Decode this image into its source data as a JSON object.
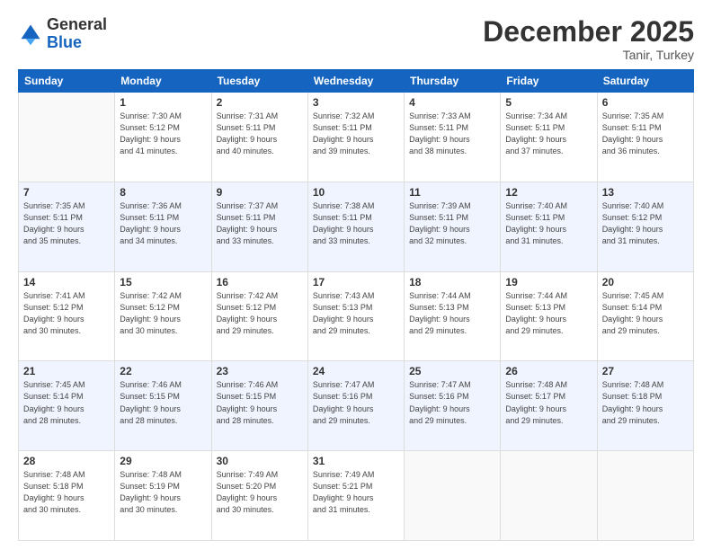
{
  "header": {
    "logo_general": "General",
    "logo_blue": "Blue",
    "month_title": "December 2025",
    "location": "Tanir, Turkey"
  },
  "days_of_week": [
    "Sunday",
    "Monday",
    "Tuesday",
    "Wednesday",
    "Thursday",
    "Friday",
    "Saturday"
  ],
  "weeks": [
    [
      {
        "num": "",
        "info": ""
      },
      {
        "num": "1",
        "info": "Sunrise: 7:30 AM\nSunset: 5:12 PM\nDaylight: 9 hours\nand 41 minutes."
      },
      {
        "num": "2",
        "info": "Sunrise: 7:31 AM\nSunset: 5:11 PM\nDaylight: 9 hours\nand 40 minutes."
      },
      {
        "num": "3",
        "info": "Sunrise: 7:32 AM\nSunset: 5:11 PM\nDaylight: 9 hours\nand 39 minutes."
      },
      {
        "num": "4",
        "info": "Sunrise: 7:33 AM\nSunset: 5:11 PM\nDaylight: 9 hours\nand 38 minutes."
      },
      {
        "num": "5",
        "info": "Sunrise: 7:34 AM\nSunset: 5:11 PM\nDaylight: 9 hours\nand 37 minutes."
      },
      {
        "num": "6",
        "info": "Sunrise: 7:35 AM\nSunset: 5:11 PM\nDaylight: 9 hours\nand 36 minutes."
      }
    ],
    [
      {
        "num": "7",
        "info": "Sunrise: 7:35 AM\nSunset: 5:11 PM\nDaylight: 9 hours\nand 35 minutes."
      },
      {
        "num": "8",
        "info": "Sunrise: 7:36 AM\nSunset: 5:11 PM\nDaylight: 9 hours\nand 34 minutes."
      },
      {
        "num": "9",
        "info": "Sunrise: 7:37 AM\nSunset: 5:11 PM\nDaylight: 9 hours\nand 33 minutes."
      },
      {
        "num": "10",
        "info": "Sunrise: 7:38 AM\nSunset: 5:11 PM\nDaylight: 9 hours\nand 33 minutes."
      },
      {
        "num": "11",
        "info": "Sunrise: 7:39 AM\nSunset: 5:11 PM\nDaylight: 9 hours\nand 32 minutes."
      },
      {
        "num": "12",
        "info": "Sunrise: 7:40 AM\nSunset: 5:11 PM\nDaylight: 9 hours\nand 31 minutes."
      },
      {
        "num": "13",
        "info": "Sunrise: 7:40 AM\nSunset: 5:12 PM\nDaylight: 9 hours\nand 31 minutes."
      }
    ],
    [
      {
        "num": "14",
        "info": "Sunrise: 7:41 AM\nSunset: 5:12 PM\nDaylight: 9 hours\nand 30 minutes."
      },
      {
        "num": "15",
        "info": "Sunrise: 7:42 AM\nSunset: 5:12 PM\nDaylight: 9 hours\nand 30 minutes."
      },
      {
        "num": "16",
        "info": "Sunrise: 7:42 AM\nSunset: 5:12 PM\nDaylight: 9 hours\nand 29 minutes."
      },
      {
        "num": "17",
        "info": "Sunrise: 7:43 AM\nSunset: 5:13 PM\nDaylight: 9 hours\nand 29 minutes."
      },
      {
        "num": "18",
        "info": "Sunrise: 7:44 AM\nSunset: 5:13 PM\nDaylight: 9 hours\nand 29 minutes."
      },
      {
        "num": "19",
        "info": "Sunrise: 7:44 AM\nSunset: 5:13 PM\nDaylight: 9 hours\nand 29 minutes."
      },
      {
        "num": "20",
        "info": "Sunrise: 7:45 AM\nSunset: 5:14 PM\nDaylight: 9 hours\nand 29 minutes."
      }
    ],
    [
      {
        "num": "21",
        "info": "Sunrise: 7:45 AM\nSunset: 5:14 PM\nDaylight: 9 hours\nand 28 minutes."
      },
      {
        "num": "22",
        "info": "Sunrise: 7:46 AM\nSunset: 5:15 PM\nDaylight: 9 hours\nand 28 minutes."
      },
      {
        "num": "23",
        "info": "Sunrise: 7:46 AM\nSunset: 5:15 PM\nDaylight: 9 hours\nand 28 minutes."
      },
      {
        "num": "24",
        "info": "Sunrise: 7:47 AM\nSunset: 5:16 PM\nDaylight: 9 hours\nand 29 minutes."
      },
      {
        "num": "25",
        "info": "Sunrise: 7:47 AM\nSunset: 5:16 PM\nDaylight: 9 hours\nand 29 minutes."
      },
      {
        "num": "26",
        "info": "Sunrise: 7:48 AM\nSunset: 5:17 PM\nDaylight: 9 hours\nand 29 minutes."
      },
      {
        "num": "27",
        "info": "Sunrise: 7:48 AM\nSunset: 5:18 PM\nDaylight: 9 hours\nand 29 minutes."
      }
    ],
    [
      {
        "num": "28",
        "info": "Sunrise: 7:48 AM\nSunset: 5:18 PM\nDaylight: 9 hours\nand 30 minutes."
      },
      {
        "num": "29",
        "info": "Sunrise: 7:48 AM\nSunset: 5:19 PM\nDaylight: 9 hours\nand 30 minutes."
      },
      {
        "num": "30",
        "info": "Sunrise: 7:49 AM\nSunset: 5:20 PM\nDaylight: 9 hours\nand 30 minutes."
      },
      {
        "num": "31",
        "info": "Sunrise: 7:49 AM\nSunset: 5:21 PM\nDaylight: 9 hours\nand 31 minutes."
      },
      {
        "num": "",
        "info": ""
      },
      {
        "num": "",
        "info": ""
      },
      {
        "num": "",
        "info": ""
      }
    ]
  ]
}
